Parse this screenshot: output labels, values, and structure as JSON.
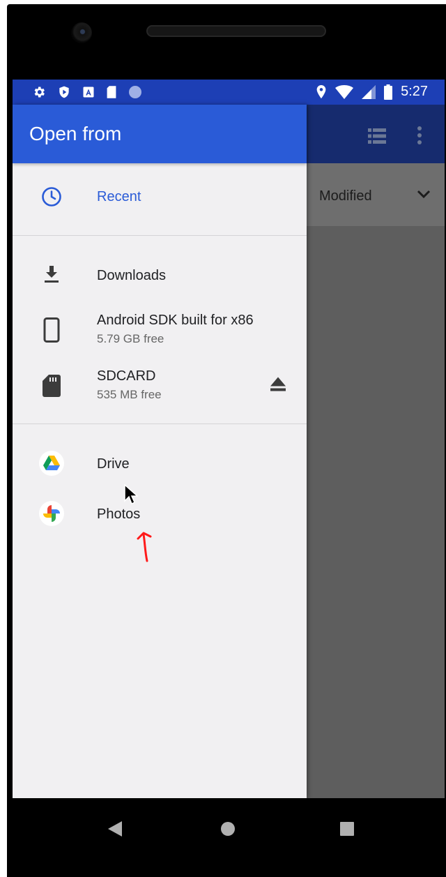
{
  "status_bar": {
    "time": "5:27",
    "left_icons": [
      "gear-icon",
      "shield-play-icon",
      "a-box-icon",
      "sd-card-small-icon",
      "dot-icon"
    ],
    "right_icons": [
      "location-icon",
      "wifi-icon",
      "signal-icon",
      "battery-icon"
    ]
  },
  "drawer": {
    "title": "Open from",
    "sections": [
      {
        "items": [
          {
            "icon": "clock-icon",
            "label": "Recent",
            "active": true
          }
        ]
      },
      {
        "items": [
          {
            "icon": "download-icon",
            "label": "Downloads"
          },
          {
            "icon": "phone-icon",
            "label": "Android SDK built for x86",
            "sublabel": "5.79 GB free"
          },
          {
            "icon": "sd-card-icon",
            "label": "SDCARD",
            "sublabel": "535 MB free",
            "action_icon": "eject-icon"
          }
        ]
      },
      {
        "items": [
          {
            "icon": "google-drive-icon",
            "label": "Drive"
          },
          {
            "icon": "google-photos-icon",
            "label": "Photos"
          }
        ]
      }
    ]
  },
  "background": {
    "sort_label": "Modified",
    "toolbar_icons": [
      "list-view-icon",
      "more-vert-icon"
    ]
  },
  "nav_bar": {
    "buttons": [
      "back-icon",
      "home-icon",
      "recents-icon"
    ]
  },
  "colors": {
    "status_bar": "#1d3fb5",
    "drawer_header": "#2a5bd7",
    "accent": "#2a5bd7",
    "drawer_bg": "#f1f0f2",
    "scrim": "#5e5e5e"
  }
}
